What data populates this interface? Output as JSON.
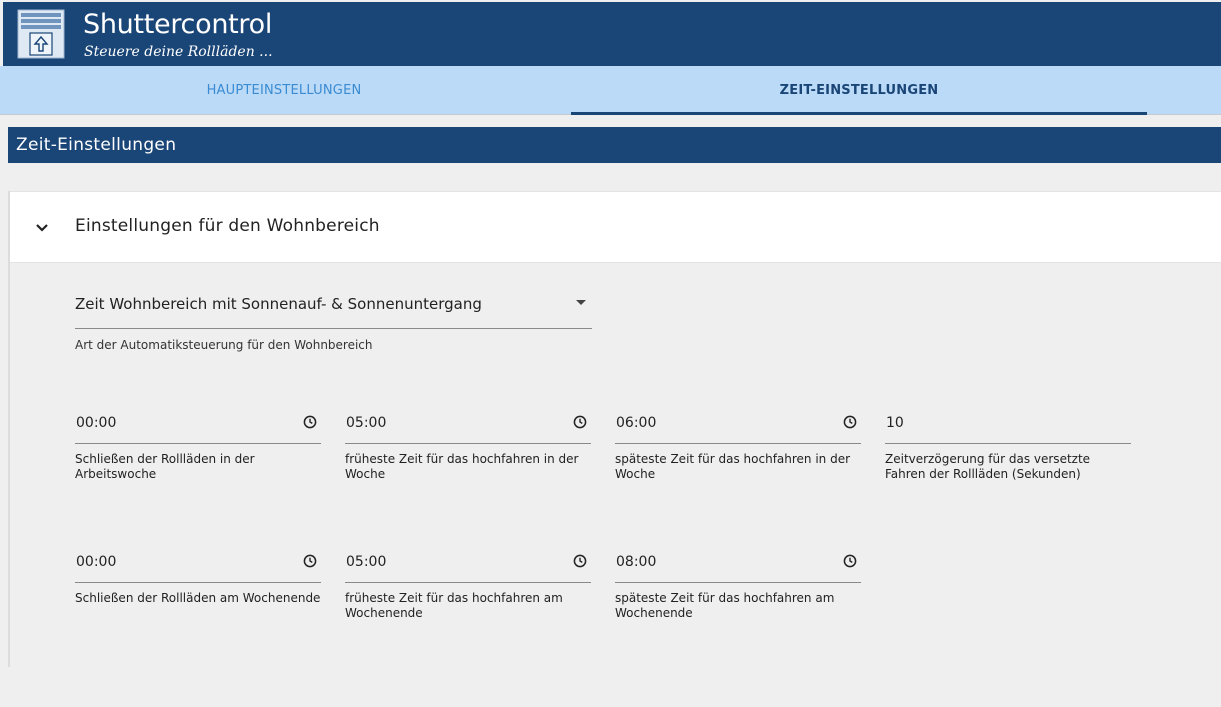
{
  "header": {
    "title": "Shuttercontrol",
    "subtitle": "Steuere deine Rollläden ..."
  },
  "tabs": [
    {
      "label": "HAUPTEINSTELLUNGEN",
      "active": false
    },
    {
      "label": "ZEIT-EINSTELLUNGEN",
      "active": true
    }
  ],
  "section": {
    "title": "Zeit-Einstellungen"
  },
  "panel": {
    "title": "Einstellungen für den Wohnbereich",
    "expanded": true,
    "mode_select": {
      "value": "Zeit Wohnbereich mit Sonnenauf- & Sonnenuntergang",
      "help": "Art der Automatiksteuerung für den Wohnbereich"
    },
    "weekday": [
      {
        "value": "00:00",
        "help": "Schließen der Rollläden in der Arbeitswoche",
        "icon": "clock-icon"
      },
      {
        "value": "05:00",
        "help": "früheste Zeit für das hochfahren in der Woche",
        "icon": "clock-icon"
      },
      {
        "value": "06:00",
        "help": "späteste Zeit für das hochfahren in der Woche",
        "icon": "clock-icon"
      },
      {
        "value": "10",
        "help": "Zeitverzögerung für das versetzte Fahren der Rollläden (Sekunden)"
      }
    ],
    "weekend": [
      {
        "value": "00:00",
        "help": "Schließen der Rollläden am Wochenende",
        "icon": "clock-icon"
      },
      {
        "value": "05:00",
        "help": "früheste Zeit für das hochfahren am Wochenende",
        "icon": "clock-icon"
      },
      {
        "value": "08:00",
        "help": "späteste Zeit für das hochfahren am Wochenende",
        "icon": "clock-icon"
      }
    ]
  },
  "colors": {
    "primary": "#1a4577",
    "tab_bar": "#bbdaf7",
    "tab_inactive": "#3a8bd2",
    "background": "#efefef"
  }
}
